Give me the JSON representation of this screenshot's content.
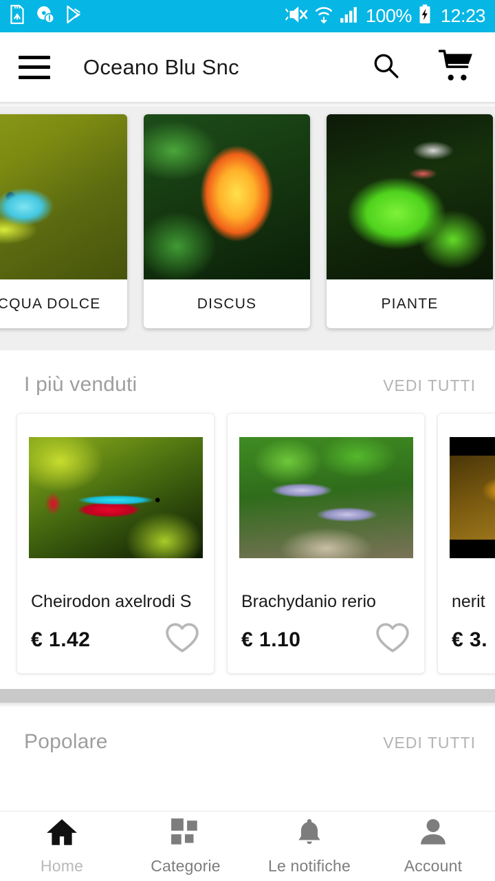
{
  "statusbar": {
    "background": "#06b6e4",
    "left_icons": [
      "sd-card-icon",
      "disc-warning-icon",
      "play-store-icon"
    ],
    "right_icons": [
      "mute-icon",
      "wifi-icon",
      "signal-icon"
    ],
    "battery_percent": "100%",
    "battery_icon": "battery-charging-icon",
    "time": "12:23"
  },
  "appbar": {
    "menu_icon": "hamburger-menu-icon",
    "title": "Oceano Blu Snc",
    "search_icon": "search-icon",
    "cart_icon": "shopping-cart-icon"
  },
  "categories": [
    {
      "label": "ACQUA DOLCE",
      "image": "guppy-fish-photo",
      "partial": true
    },
    {
      "label": "DISCUS",
      "image": "discus-fish-photo",
      "partial": false
    },
    {
      "label": "PIANTE",
      "image": "aquarium-plants-photo",
      "partial": false
    },
    {
      "label": "",
      "image": "aquarium-photo",
      "partial": true
    }
  ],
  "sections": [
    {
      "title": "I più venduti",
      "see_all": "VEDI TUTTI",
      "products": [
        {
          "name": "Cheirodon  axelrodi    S",
          "price": "€ 1.42",
          "image": "cardinal-tetra-photo",
          "favorite_icon": "heart-outline-icon"
        },
        {
          "name": "Brachydanio   rerio",
          "price": "€ 1.10",
          "image": "zebra-danio-photo",
          "favorite_icon": "heart-outline-icon"
        },
        {
          "name": "nerit",
          "price": "€ 3.",
          "image": "neritina-snail-photo",
          "favorite_icon": "heart-outline-icon"
        }
      ]
    },
    {
      "title": "Popolare",
      "see_all": "VEDI TUTTI",
      "products": []
    }
  ],
  "bottomnav": {
    "items": [
      {
        "label": "Home",
        "icon": "home-icon",
        "active": true
      },
      {
        "label": "Categorie",
        "icon": "grid-categories-icon",
        "active": false
      },
      {
        "label": "Le notifiche",
        "icon": "bell-icon",
        "active": false
      },
      {
        "label": "Account",
        "icon": "person-icon",
        "active": false
      }
    ]
  }
}
